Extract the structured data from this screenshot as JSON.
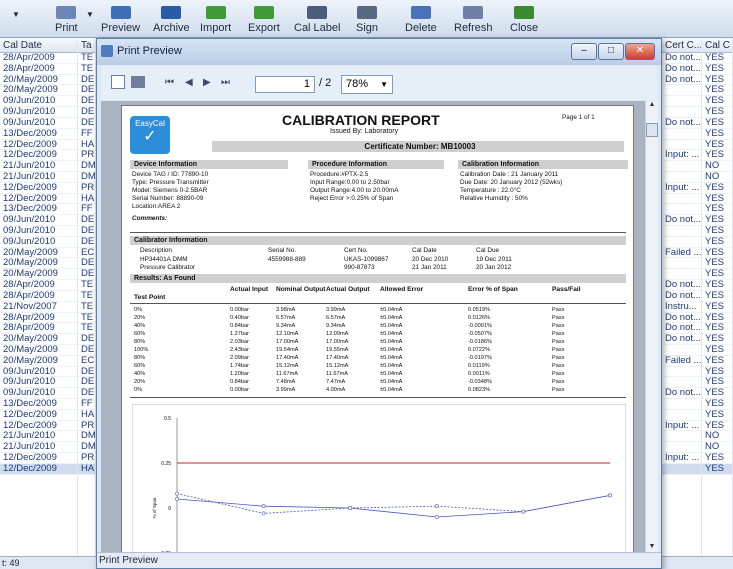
{
  "toolbar": {
    "buttons": [
      {
        "label": "Print"
      },
      {
        "label": "Preview"
      },
      {
        "label": "Archive"
      },
      {
        "label": "Import"
      },
      {
        "label": "Export"
      },
      {
        "label": "Cal Label"
      },
      {
        "label": "Sign"
      },
      {
        "label": "Delete"
      },
      {
        "label": "Refresh"
      },
      {
        "label": "Close"
      }
    ]
  },
  "grid": {
    "col_caldate": "Cal Date",
    "col_ta": "Ta",
    "col_certc": "Cert C...",
    "col_cal": "Cal C",
    "dates": [
      "28/Apr/2009",
      "28/Apr/2009",
      "20/May/2009",
      "20/May/2009",
      "09/Jun/2010",
      "09/Jun/2010",
      "09/Jun/2010",
      "13/Dec/2009",
      "12/Dec/2009",
      "12/Dec/2009",
      "21/Jun/2010",
      "21/Jun/2010",
      "12/Dec/2009",
      "12/Dec/2009",
      "13/Dec/2009",
      "09/Jun/2010",
      "09/Jun/2010",
      "09/Jun/2010",
      "20/May/2009",
      "20/May/2009",
      "20/May/2009",
      "28/Apr/2009",
      "28/Apr/2009",
      "21/Nov/2007",
      "28/Apr/2009",
      "28/Apr/2009",
      "20/May/2009",
      "20/May/2009",
      "20/May/2009",
      "09/Jun/2010",
      "09/Jun/2010",
      "09/Jun/2010",
      "13/Dec/2009",
      "12/Dec/2009",
      "12/Dec/2009",
      "21/Jun/2010",
      "21/Jun/2010",
      "12/Dec/2009",
      "12/Dec/2009"
    ],
    "ta": [
      "TE",
      "TE",
      "DE",
      "DE",
      "DE",
      "DE",
      "DE",
      "FF",
      "HA",
      "PR",
      "DM",
      "DM",
      "PR",
      "HA",
      "FF",
      "DE",
      "DE",
      "DE",
      "EC",
      "DE",
      "DE",
      "TE",
      "TE",
      "TE",
      "TE",
      "TE",
      "DE",
      "DE",
      "EC",
      "DE",
      "DE",
      "DE",
      "FF",
      "HA",
      "PR",
      "DM",
      "DM",
      "PR",
      "HA"
    ],
    "cert": [
      "Do not...",
      "Do not...",
      "Do not...",
      "",
      "",
      "",
      "Do not...",
      "",
      "",
      "Input: ...",
      "",
      "",
      "Input: ...",
      "",
      "",
      "Do not...",
      "",
      "",
      "Failed ...",
      "",
      "",
      "Do not...",
      "Do not...",
      "Instru...",
      "Do not...",
      "Do not...",
      "Do not...",
      "",
      "Failed ...",
      "",
      "",
      "Do not...",
      "",
      "",
      "Input: ...",
      "",
      "",
      "Input: ...",
      ""
    ],
    "calc": [
      "YES",
      "YES",
      "YES",
      "YES",
      "YES",
      "YES",
      "YES",
      "YES",
      "YES",
      "YES",
      "NO",
      "NO",
      "YES",
      "YES",
      "YES",
      "YES",
      "YES",
      "YES",
      "YES",
      "YES",
      "YES",
      "YES",
      "YES",
      "YES",
      "YES",
      "YES",
      "YES",
      "YES",
      "YES",
      "YES",
      "YES",
      "YES",
      "YES",
      "YES",
      "YES",
      "NO",
      "NO",
      "YES",
      "YES"
    ]
  },
  "status_text": "t: 49",
  "preview": {
    "window_title": "Print Preview",
    "page_value": "1",
    "page_total": "/ 2",
    "zoom": "78%",
    "status": "Print Preview"
  },
  "report": {
    "logo_text": "EasyCal",
    "title": "CALIBRATION REPORT",
    "issued": "Issued By: Laboratory",
    "page": "Page 1 of 1",
    "cert_number": "Certificate Number: MB10003",
    "device_header": "Device Information",
    "procedure_header": "Procedure Information",
    "calinfo_header": "Calibration Information",
    "device_lines": [
      "Device TAG / ID: 77890-10",
      "Type: Pressure Transmitter",
      "Model: Siemens 0-2.5BAR",
      "Serial Number: 88890-09",
      "Location:AREA 2"
    ],
    "procedure_lines": [
      "Procedure:#PTX-2.5",
      "Input Range:0.00 to 2.50bar",
      "Output Range:4.00 to 20.00mA",
      "Reject Error >:0.25% of Span"
    ],
    "calinfo_lines": [
      "Calibration Date : 21 January 2011",
      "Due Date: 20 January 2012 (52wks)",
      "Temperature : 22.0°C",
      "Relative Humidity : 50%"
    ],
    "comments": "Comments:",
    "calibrator_header": "Calibrator Information",
    "calibrator_cols": [
      "Description",
      "Serial No.",
      "Cert No.",
      "Cal Date",
      "Cal Due"
    ],
    "calibrators": [
      [
        "HP34401A DMM",
        "4559988-889",
        "UKAS-1099867",
        "20 Dec 2010",
        "19 Dec 2011"
      ],
      [
        "Pressure Calibrator",
        "",
        "990-87873",
        "21 Jan 2011",
        "20 Jan 2012"
      ]
    ],
    "results_header": "Results: As Found",
    "results_cols": [
      "Test Point",
      "Actual Input",
      "Nominal Output",
      "Actual Output",
      "Allowed Error",
      "Error % of Span",
      "Pass/Fail"
    ],
    "results": [
      [
        "0%",
        "0.00bar",
        "3.98mA",
        "3.99mA",
        "±0.04mA",
        "0.0519%",
        "Pass"
      ],
      [
        "20%",
        "0.40bar",
        "6.57mA",
        "6.57mA",
        "±0.04mA",
        "0.0126%",
        "Pass"
      ],
      [
        "40%",
        "0.84bar",
        "9.34mA",
        "9.34mA",
        "±0.04mA",
        "-0.0001%",
        "Pass"
      ],
      [
        "60%",
        "1.27bar",
        "12.10mA",
        "12.09mA",
        "±0.04mA",
        "-0.0507%",
        "Pass"
      ],
      [
        "80%",
        "2.03bar",
        "17.00mA",
        "17.00mA",
        "±0.04mA",
        "-0.0186%",
        "Pass"
      ],
      [
        "100%",
        "2.43bar",
        "19.54mA",
        "19.55mA",
        "±0.04mA",
        "0.0722%",
        "Pass"
      ],
      [
        "80%",
        "2.09bar",
        "17.40mA",
        "17.40mA",
        "±0.04mA",
        "-0.0197%",
        "Pass"
      ],
      [
        "60%",
        "1.74bar",
        "15.12mA",
        "15.12mA",
        "±0.04mA",
        "0.0119%",
        "Pass"
      ],
      [
        "40%",
        "1.20bar",
        "11.67mA",
        "11.67mA",
        "±0.04mA",
        "0.0011%",
        "Pass"
      ],
      [
        "20%",
        "0.84bar",
        "7.48mA",
        "7.47mA",
        "±0.04mA",
        "-0.0348%",
        "Pass"
      ],
      [
        "0%",
        "0.00bar",
        "3.99mA",
        "4.00mA",
        "±0.04mA",
        "0.0823%",
        "Pass"
      ]
    ]
  },
  "chart_data": {
    "type": "line",
    "ylabel": "% of Span",
    "ylim": [
      -0.3,
      0.5
    ],
    "yticks": [
      "0.5",
      "0.25",
      "0",
      "-0.25"
    ],
    "limits": [
      0.25,
      -0.25
    ],
    "series": [
      {
        "values": [
          0.05,
          0.01,
          0.0,
          -0.05,
          -0.02,
          0.07
        ]
      },
      {
        "values": [
          0.08,
          -0.03,
          0.0,
          0.01,
          -0.02,
          0.07
        ]
      }
    ],
    "colors": {
      "limit": "#cc2222",
      "series": "#4b57b8"
    }
  }
}
